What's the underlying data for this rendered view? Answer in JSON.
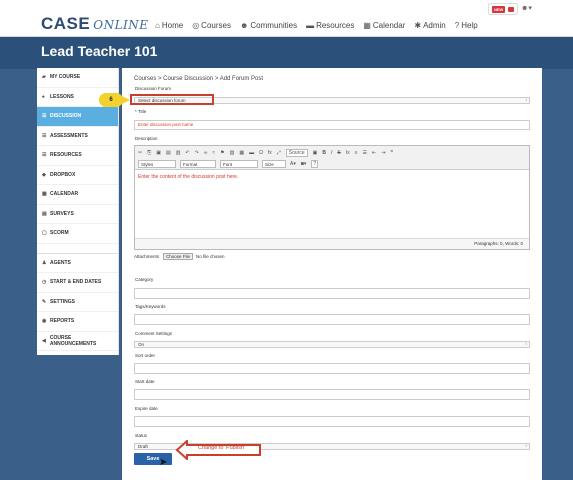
{
  "brand": {
    "name": "CASE",
    "suffix": "ONLINE"
  },
  "nav": [
    {
      "label": "Home",
      "icon": "home-icon",
      "glyph": "⌂"
    },
    {
      "label": "Courses",
      "icon": "courses-icon",
      "glyph": "◎"
    },
    {
      "label": "Communities",
      "icon": "communities-icon",
      "glyph": "☻"
    },
    {
      "label": "Resources",
      "icon": "folder-icon",
      "glyph": "▬"
    },
    {
      "label": "Calendar",
      "icon": "calendar-icon",
      "glyph": "▦"
    },
    {
      "label": "Admin",
      "icon": "gear-icon",
      "glyph": "✱"
    },
    {
      "label": "Help",
      "icon": "help-icon",
      "glyph": "?"
    }
  ],
  "header_badge": "NEW",
  "page_title": "Lead Teacher 101",
  "sidebar": [
    {
      "label": "MY COURSE",
      "glyph": "▰"
    },
    {
      "label": "LESSONS",
      "glyph": "♠"
    },
    {
      "label": "DISCUSSION",
      "glyph": "☰",
      "active": true
    },
    {
      "label": "ASSESSMENTS",
      "glyph": "☰"
    },
    {
      "label": "RESOURCES",
      "glyph": "☰"
    },
    {
      "label": "DROPBOX",
      "glyph": "◆"
    },
    {
      "label": "CALENDAR",
      "glyph": "▦"
    },
    {
      "label": "SURVEYS",
      "glyph": "▤"
    },
    {
      "label": "SCORM",
      "glyph": "▢"
    },
    {
      "label": "AGENTS",
      "glyph": "♟"
    },
    {
      "label": "START & END DATES",
      "glyph": "◷"
    },
    {
      "label": "SETTINGS",
      "glyph": "✎"
    },
    {
      "label": "REPORTS",
      "glyph": "◉"
    },
    {
      "label": "COURSE ANNOUNCEMENTS",
      "glyph": "◀"
    }
  ],
  "breadcrumb": "Courses > Course Discussion > Add Forum Post",
  "form": {
    "forum_label": "Discussion Forum",
    "forum_value": "Select discussion forum",
    "title_label": "* Title",
    "title_placeholder": "Enter discussion post name",
    "desc_label": "Description",
    "desc_placeholder": "Enter the content of the discussion post here.",
    "editor_status": "Paragraphs: 0, Words: 0",
    "attach_label": "Attachments",
    "choose_file": "Choose File",
    "no_file": "No file chosen",
    "category_label": "Category",
    "tags_label": "Tags/Keywords",
    "comment_label": "Comment Settings",
    "comment_value": "On",
    "sort_label": "Sort order",
    "start_label": "Start date",
    "expire_label": "Expire date",
    "status_label": "status",
    "status_value": "Draft",
    "save_label": "Save"
  },
  "toolbar": {
    "source": "Source",
    "styles": "Styles",
    "format": "Format",
    "font": "Font",
    "size": "Size"
  },
  "annotations": {
    "step": "6",
    "change_note": "Change to 'Publish'"
  },
  "colors": {
    "accent": "#5aafe0",
    "banner": "#2b517b",
    "callout": "#f3d22e",
    "annotation_red": "#c8402d"
  }
}
